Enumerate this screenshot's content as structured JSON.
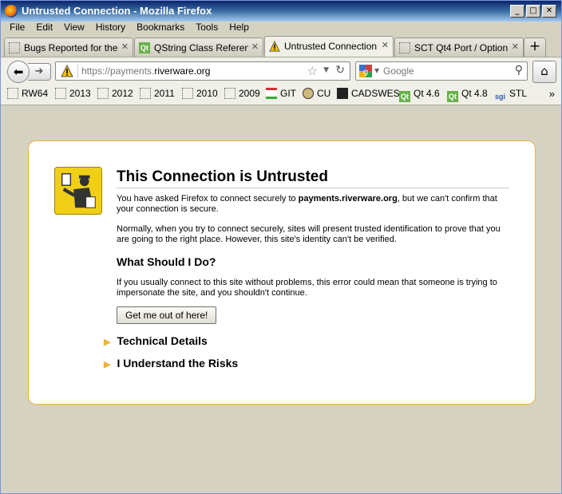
{
  "window": {
    "title": "Untrusted Connection - Mozilla Firefox"
  },
  "menu": [
    "File",
    "Edit",
    "View",
    "History",
    "Bookmarks",
    "Tools",
    "Help"
  ],
  "tabs": [
    {
      "label": "Bugs Reported for the ...",
      "icon": "blank-page-icon",
      "active": false
    },
    {
      "label": "QString Class Referen...",
      "icon": "qt-icon",
      "active": false
    },
    {
      "label": "Untrusted Connection",
      "icon": "warning-icon",
      "active": true
    },
    {
      "label": "SCT Qt4 Port / Option...",
      "icon": "blank-page-icon",
      "active": false
    }
  ],
  "nav": {
    "url_prefix": "https://payments.",
    "url_domain": "riverware.org",
    "search_placeholder": "Google"
  },
  "bookmarks": [
    {
      "label": "RW64",
      "icon": "folder-icon"
    },
    {
      "label": "2013",
      "icon": "folder-icon"
    },
    {
      "label": "2012",
      "icon": "folder-icon"
    },
    {
      "label": "2011",
      "icon": "folder-icon"
    },
    {
      "label": "2010",
      "icon": "folder-icon"
    },
    {
      "label": "2009",
      "icon": "folder-icon"
    },
    {
      "label": "GIT",
      "icon": "git-icon"
    },
    {
      "label": "CU",
      "icon": "cu-icon"
    },
    {
      "label": "CADSWES",
      "icon": "cadswes-icon"
    },
    {
      "label": "Qt 4.6",
      "icon": "qt-icon"
    },
    {
      "label": "Qt 4.8",
      "icon": "qt-icon"
    },
    {
      "label": "STL",
      "icon": "sgi-icon"
    }
  ],
  "page": {
    "title": "This Connection is Untrusted",
    "p1_before": "You have asked Firefox to connect securely to ",
    "p1_host": "payments.riverware.org",
    "p1_after": ", but we can't confirm that your connection is secure.",
    "p2": "Normally, when you try to connect securely, sites will present trusted identification to prove that you are going to the right place. However, this site's identity can't be verified.",
    "what_heading": "What Should I Do?",
    "p3": "If you usually connect to this site without problems, this error could mean that someone is trying to impersonate the site, and you shouldn't continue.",
    "button": "Get me out of here!",
    "technical": "Technical Details",
    "understand": "I Understand the Risks"
  },
  "colors": {
    "accent_border": "#e8b53b",
    "titlebar": "#0a246a"
  }
}
